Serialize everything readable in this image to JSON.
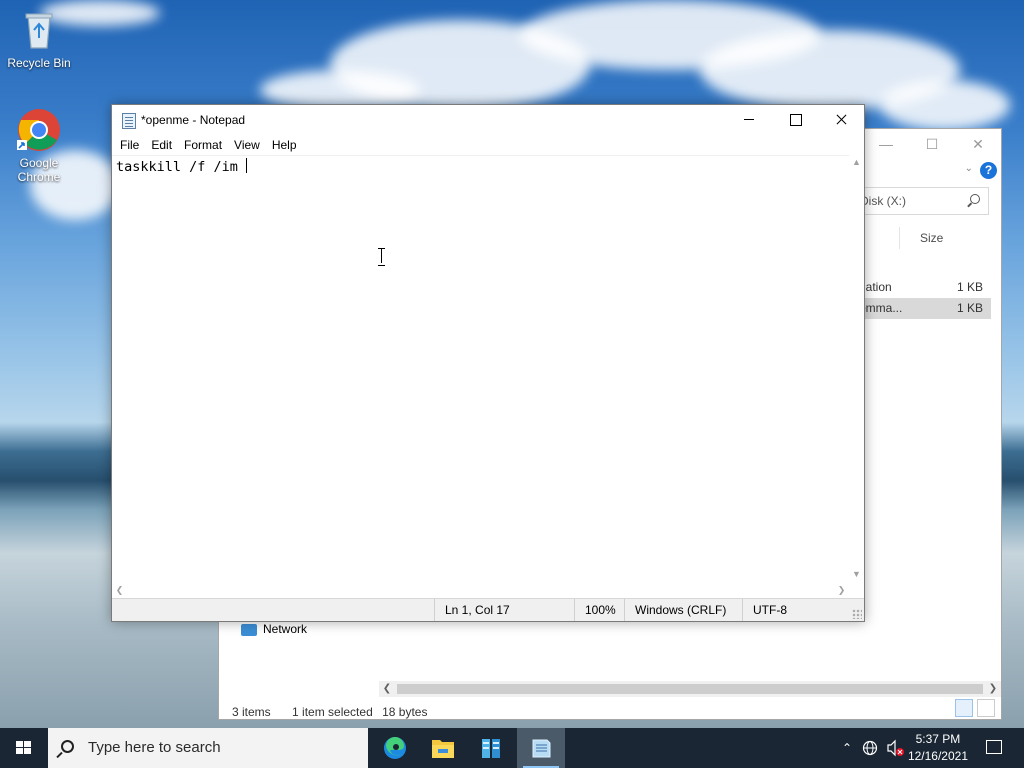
{
  "desktop": {
    "icons": [
      {
        "label": "Recycle Bin"
      },
      {
        "label": "Google Chrome"
      }
    ]
  },
  "explorer": {
    "search_placeholder": "Disk (X:)",
    "column_size": "Size",
    "files": [
      {
        "name": "nation",
        "size": "1 KB",
        "selected": false
      },
      {
        "name": "omma...",
        "size": "1 KB",
        "selected": true
      }
    ],
    "nav_network": "Network",
    "status": {
      "items": "3 items",
      "selected": "1 item selected",
      "bytes": "18 bytes"
    }
  },
  "notepad": {
    "title": "*openme - Notepad",
    "menu": [
      "File",
      "Edit",
      "Format",
      "View",
      "Help"
    ],
    "content": "taskkill /f /im ",
    "status": {
      "position": "Ln 1, Col 17",
      "zoom": "100%",
      "line_ending": "Windows (CRLF)",
      "encoding": "UTF-8"
    }
  },
  "taskbar": {
    "search_placeholder": "Type here to search",
    "apps": [
      {
        "icon": "edge-icon",
        "active": false
      },
      {
        "icon": "file-explorer-icon",
        "active": false
      },
      {
        "icon": "server-manager-icon",
        "active": false
      },
      {
        "icon": "notepad-icon",
        "active": true
      }
    ],
    "clock": {
      "time": "5:37 PM",
      "date": "12/16/2021"
    }
  }
}
